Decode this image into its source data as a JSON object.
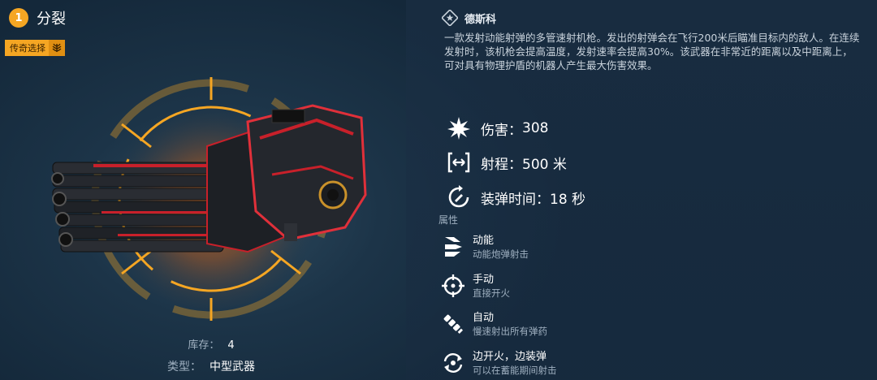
{
  "header": {
    "level": "1",
    "weapon_name": "分裂",
    "rarity_label": "传奇选择"
  },
  "inventory": {
    "stock_label": "库存：",
    "stock_value": "4",
    "type_label": "类型：",
    "type_value": "中型武器"
  },
  "maker": {
    "name": "德斯科"
  },
  "description": "一款发射动能射弹的多管速射机枪。发出的射弹会在飞行200米后瞄准目标内的敌人。在连续发射时，该机枪会提高温度，发射速率会提高30%。该武器在非常近的距离以及中距离上，可对具有物理护盾的机器人产生最大伤害效果。",
  "stats": [
    {
      "label": "伤害：",
      "value": "308",
      "icon": "burst-icon"
    },
    {
      "label": "射程：",
      "value": "500 米",
      "icon": "range-icon"
    },
    {
      "label": "装弹时间：",
      "value": "18 秒",
      "icon": "reload-icon"
    }
  ],
  "attributes": {
    "section_label": "属性",
    "items": [
      {
        "title": "动能",
        "subtitle": "动能炮弹射击",
        "icon": "kinetic-icon"
      },
      {
        "title": "手动",
        "subtitle": "直接开火",
        "icon": "crosshair-icon"
      },
      {
        "title": "自动",
        "subtitle": "慢速射出所有弹药",
        "icon": "ammo-belt-icon"
      },
      {
        "title": "边开火，边装弹",
        "subtitle": "可以在蓄能期间射击",
        "icon": "cycle-reload-icon"
      }
    ]
  },
  "colors": {
    "accent": "#f5a623",
    "weapon_red": "#c8202a",
    "text_secondary": "#9fb0c0"
  }
}
